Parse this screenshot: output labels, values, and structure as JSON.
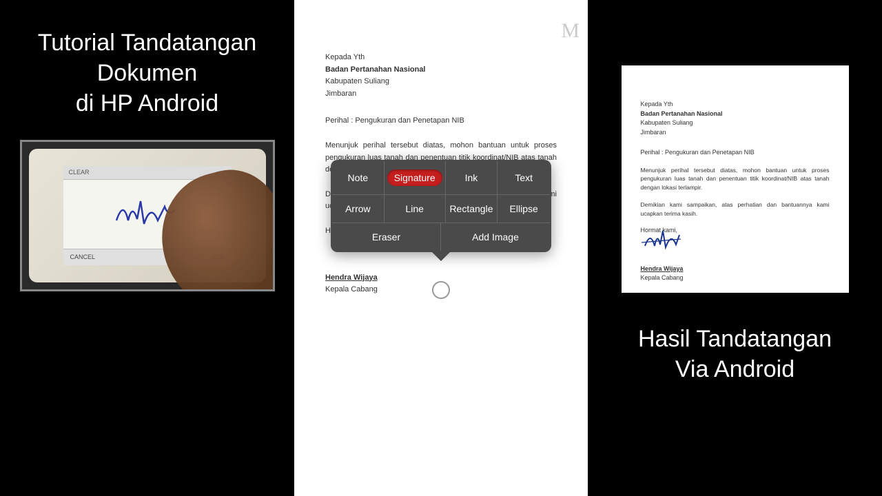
{
  "left": {
    "title_line1": "Tutorial Tandatangan",
    "title_line2": "Dokumen",
    "title_line3": "di HP Android",
    "phone_clear": "CLEAR",
    "phone_cancel": "CANCEL",
    "phone_add": "ADD"
  },
  "doc": {
    "addr1": "Kepada Yth",
    "addr2": "Badan Pertanahan Nasional",
    "addr3": "Kabupaten Suliang",
    "addr4": "Jimbaran",
    "perihal": "Perihal : Pengukuran dan Penetapan NIB",
    "body": "Menunjuk perihal tersebut diatas, mohon bantuan untuk proses pengukuran luas tanah dan penentuan titik koordinat/NIB atas tanah dengan lokasi terlampir.",
    "closing": "Demikian kami sampaikan, atas perhatian dan bantuannya kami ucapkan terima kasih.",
    "hormat": "Hormat kami,",
    "sig_name": "Hendra Wijaya",
    "sig_title": "Kepala Cabang"
  },
  "watermark": "M",
  "tools": {
    "note": "Note",
    "signature": "Signature",
    "ink": "Ink",
    "text": "Text",
    "arrow": "Arrow",
    "line": "Line",
    "rectangle": "Rectangle",
    "ellipse": "Ellipse",
    "eraser": "Eraser",
    "add_image": "Add Image"
  },
  "right": {
    "title_line1": "Hasil Tandatangan",
    "title_line2": "Via Android"
  }
}
